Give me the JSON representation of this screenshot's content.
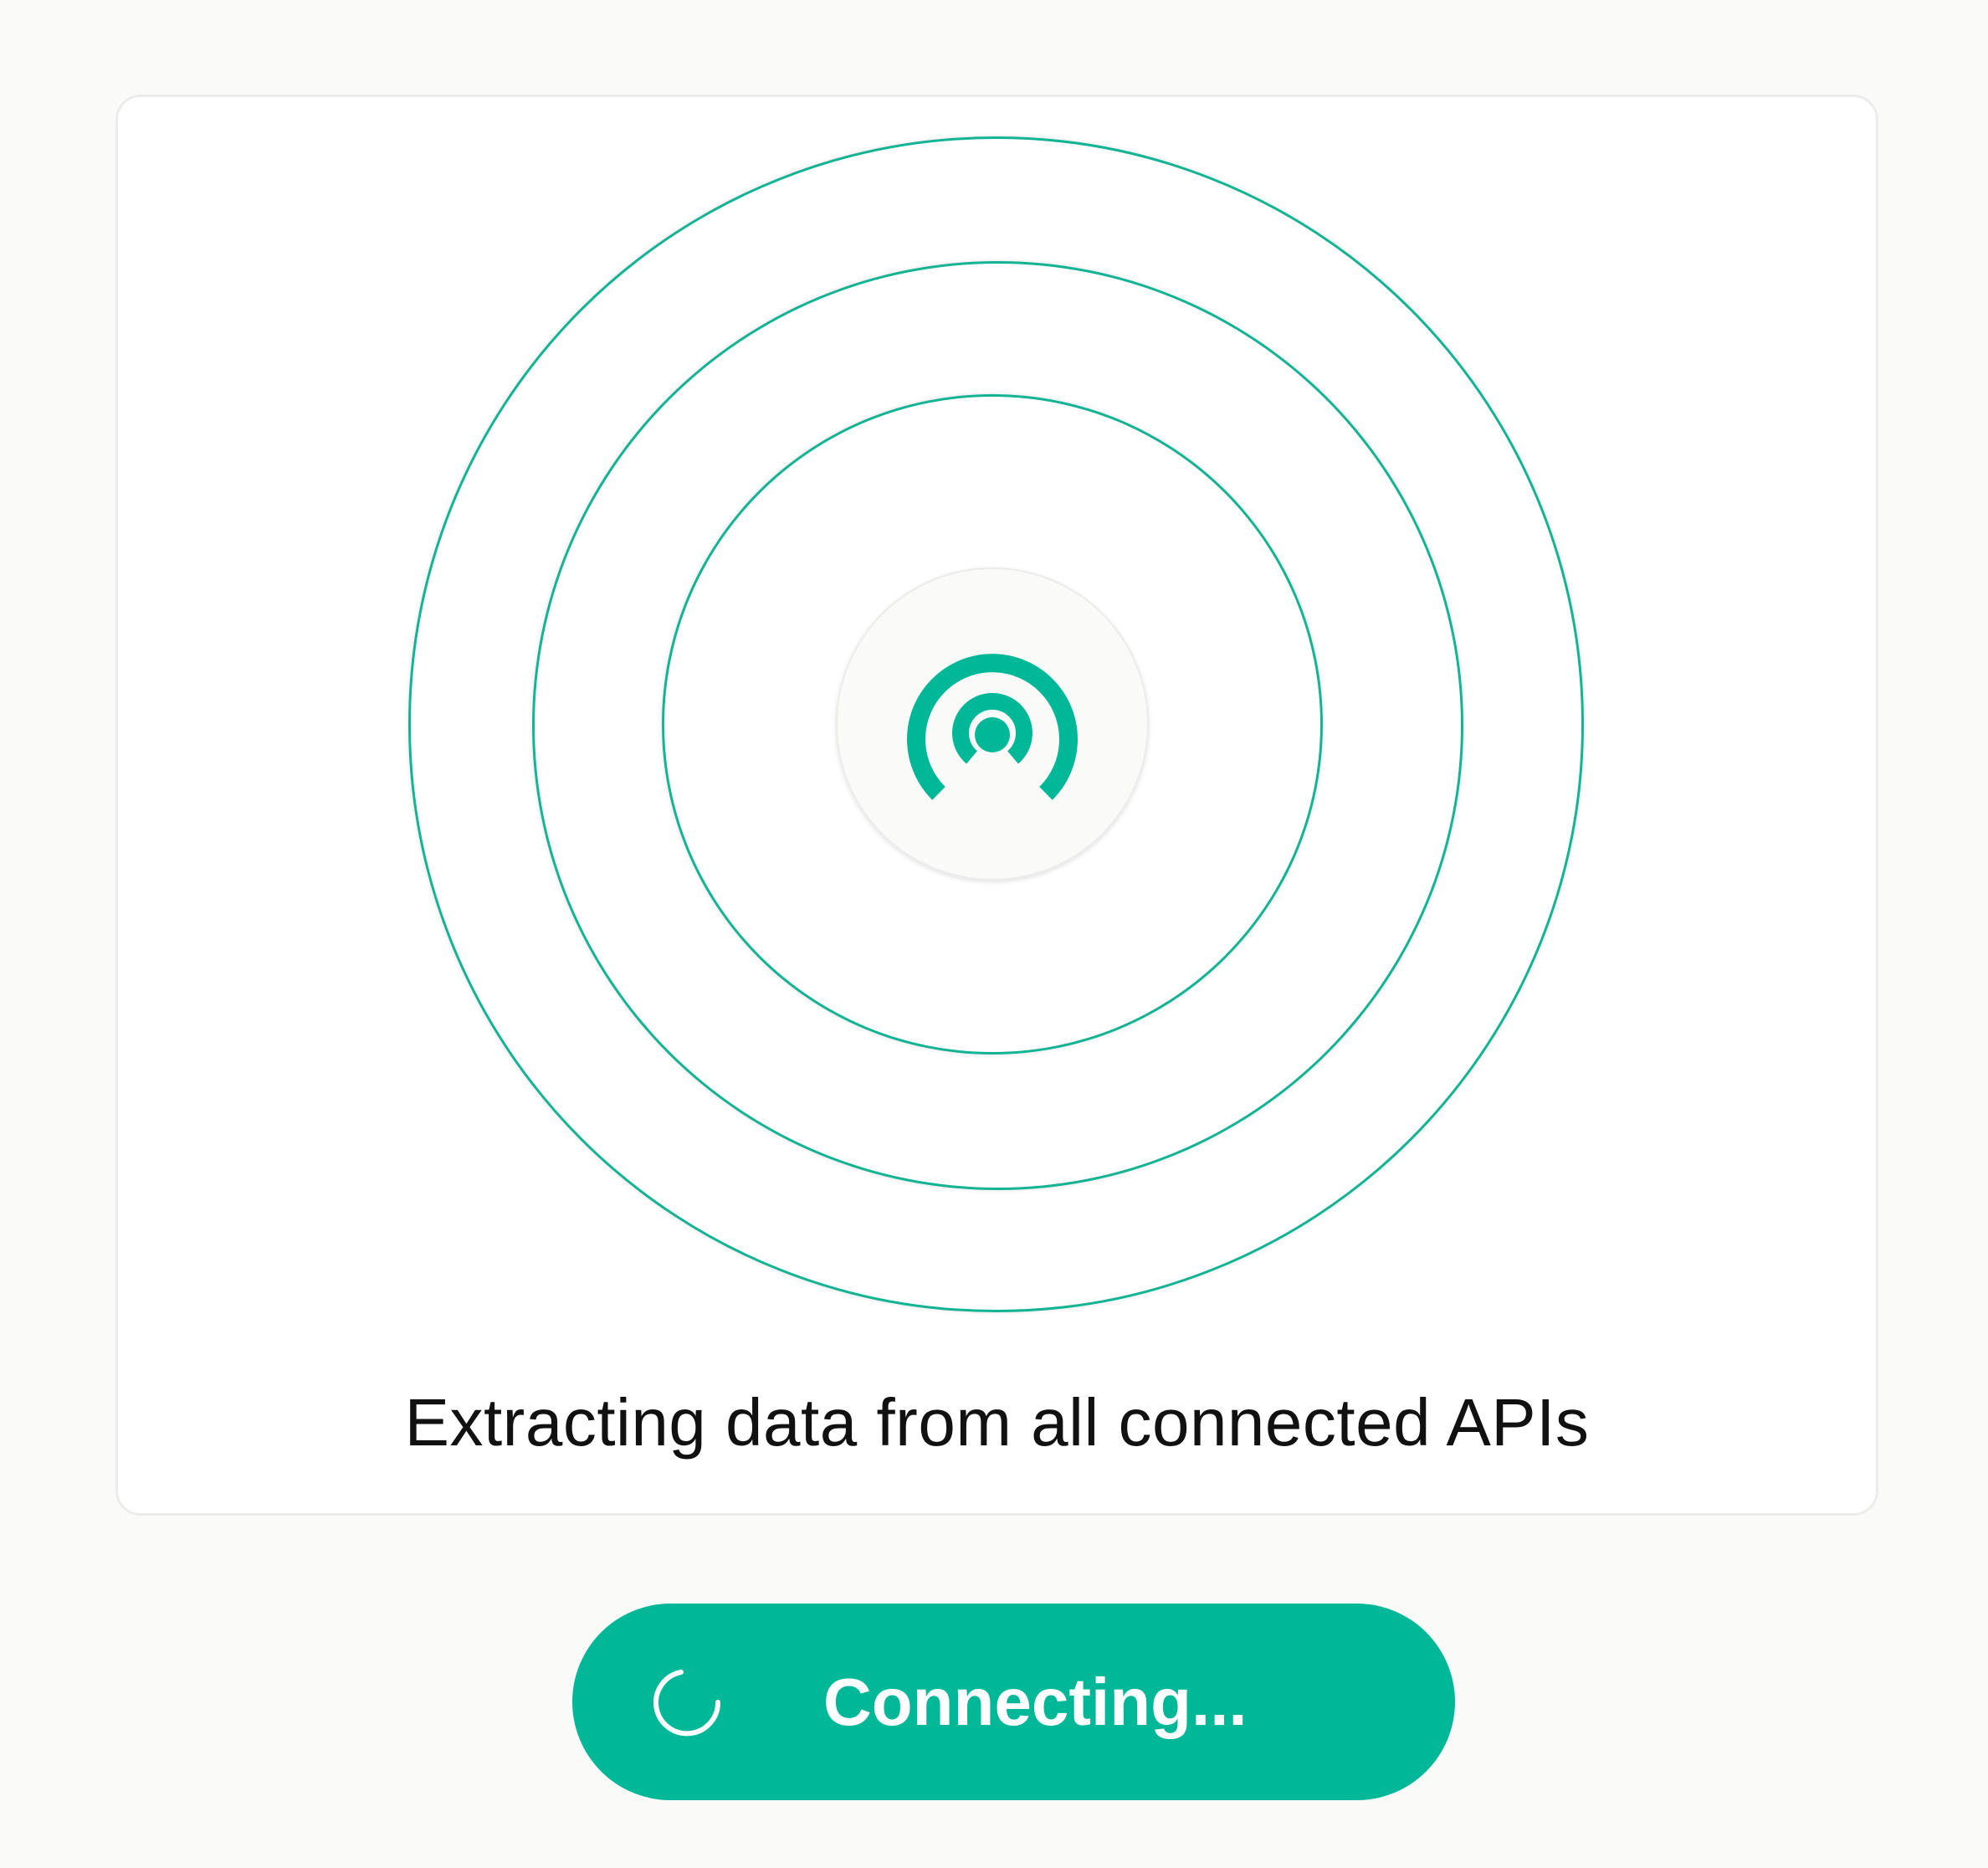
{
  "status": {
    "message": "Extracting data from all connected APIs"
  },
  "button": {
    "label": "Connecting...",
    "state": "loading"
  },
  "icons": {
    "center": "broadcast-signal-icon",
    "button": "spinner-icon"
  },
  "colors": {
    "accent": "#00b898",
    "ring": "#14b394",
    "background": "#fafaf9",
    "card": "#ffffff",
    "text": "#111111"
  }
}
